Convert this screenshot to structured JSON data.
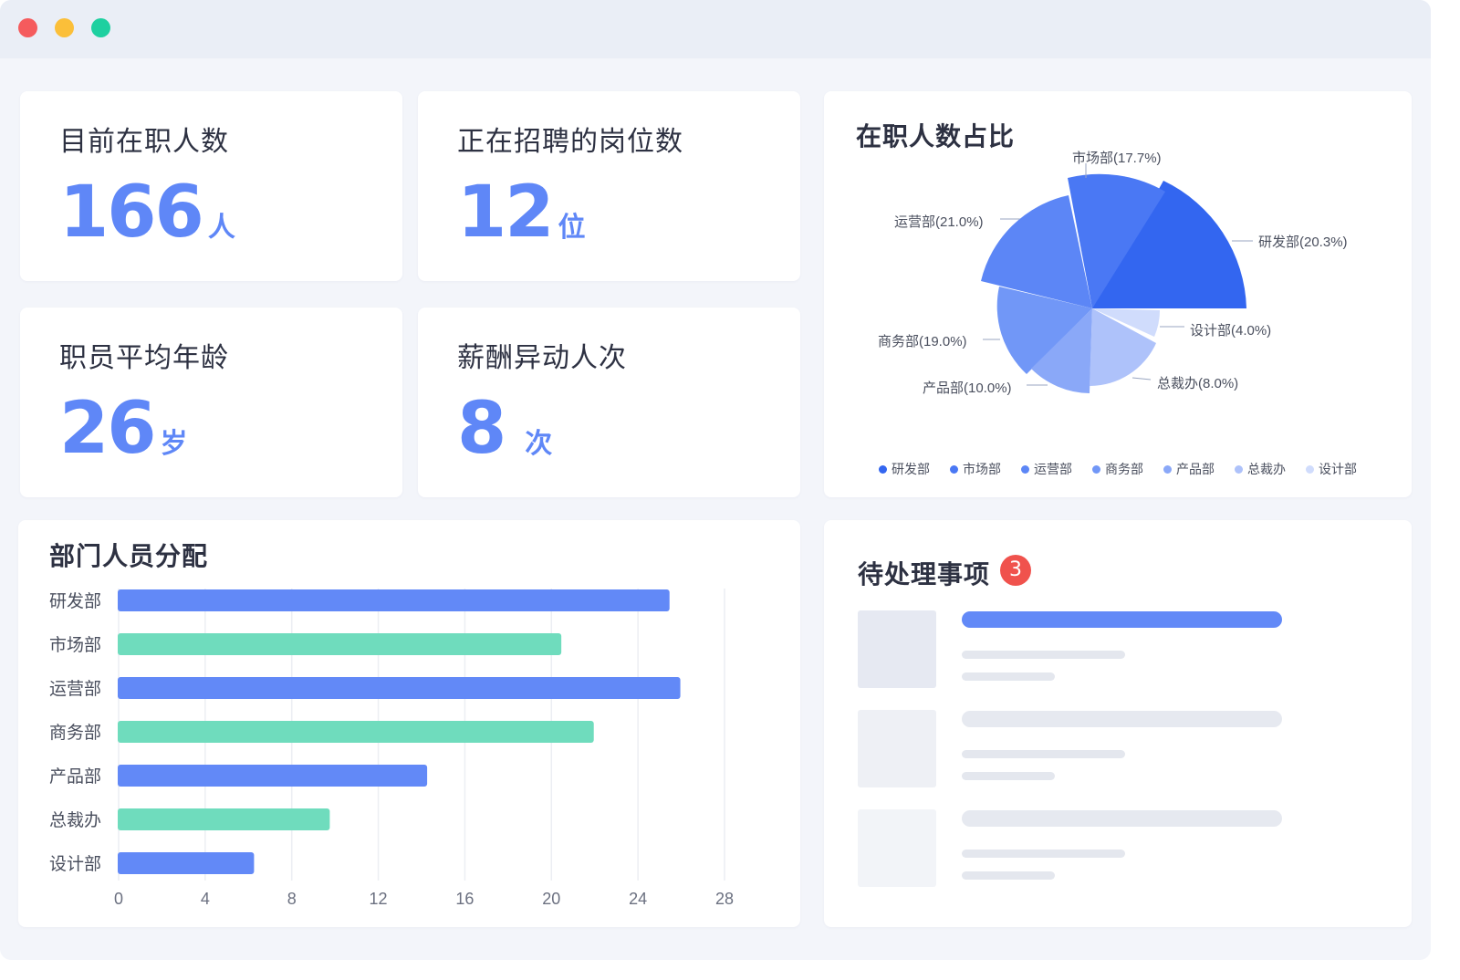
{
  "window": {
    "controls": [
      "close",
      "minimize",
      "maximize"
    ]
  },
  "stats": [
    {
      "title": "目前在职人数",
      "value": "166",
      "unit": "人"
    },
    {
      "title": "正在招聘的岗位数",
      "value": "12",
      "unit": "位"
    },
    {
      "title": "职员平均年龄",
      "value": "26",
      "unit": "岁"
    },
    {
      "title": "薪酬异动人次",
      "value": "8",
      "unit": "次"
    }
  ],
  "pie": {
    "title": "在职人数占比",
    "labels": {
      "yanfa": "研发部(20.3%)",
      "shichang": "市场部(17.7%)",
      "yunying": "运营部(21.0%)",
      "shangwu": "商务部(19.0%)",
      "chanpin": "产品部(10.0%)",
      "zongcai": "总裁办(8.0%)",
      "sheji": "设计部(4.0%)"
    },
    "legend": [
      "研发部",
      "市场部",
      "运营部",
      "商务部",
      "产品部",
      "总裁办",
      "设计部"
    ],
    "colors": [
      "#3366f0",
      "#4a78f4",
      "#5c86f6",
      "#7197f7",
      "#8aa8f8",
      "#aec2fa",
      "#d0dcfc"
    ]
  },
  "bar": {
    "title": "部门人员分配"
  },
  "todo": {
    "title": "待处理事项",
    "badge": "3"
  },
  "chart_data": {
    "type": "bar",
    "orientation": "horizontal",
    "title": "部门人员分配",
    "categories": [
      "研发部",
      "市场部",
      "运营部",
      "商务部",
      "产品部",
      "总裁办",
      "设计部"
    ],
    "values": [
      25.5,
      20.5,
      26,
      22,
      14.3,
      9.8,
      6.3
    ],
    "xlim": [
      0,
      28
    ],
    "xticks": [
      "0",
      "4",
      "8",
      "12",
      "16",
      "20",
      "24",
      "28"
    ],
    "colors": [
      "#6289f7",
      "#6fdcbd",
      "#6289f7",
      "#6fdcbd",
      "#6289f7",
      "#6fdcbd",
      "#6289f7"
    ],
    "grid": true
  }
}
